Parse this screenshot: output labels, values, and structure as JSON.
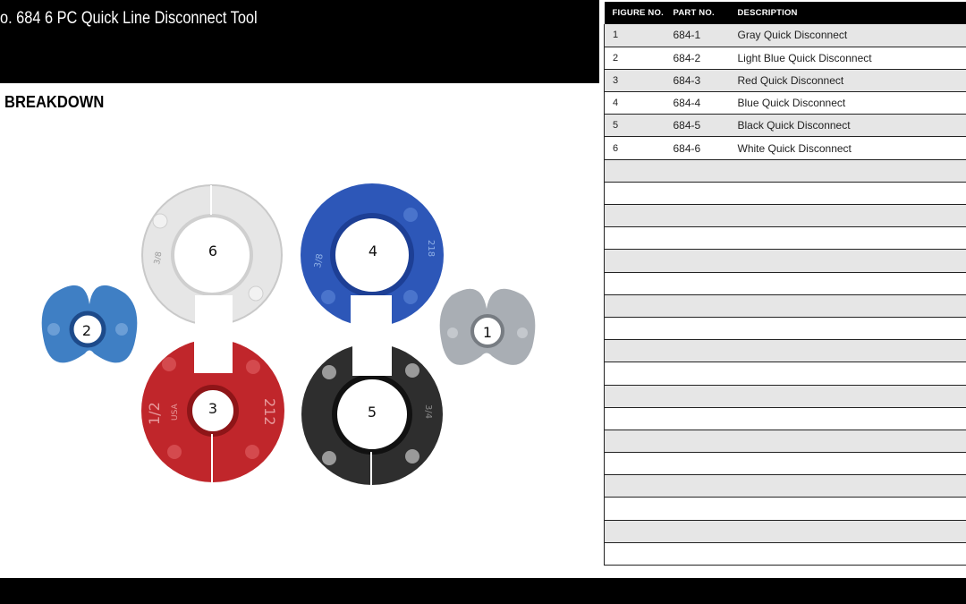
{
  "header": {
    "title": "o. 684 6 PC Quick Line Disconnect Tool"
  },
  "section": {
    "heading": "BREAKDOWN"
  },
  "table": {
    "columns": [
      "FIGURE NO.",
      "PART NO.",
      "DESCRIPTION"
    ],
    "rows": [
      [
        "1",
        "684-1",
        "Gray Quick Disconnect"
      ],
      [
        "2",
        "684-2",
        "Light Blue Quick Disconnect"
      ],
      [
        "3",
        "684-3",
        "Red Quick Disconnect"
      ],
      [
        "4",
        "684-4",
        "Blue Quick Disconnect"
      ],
      [
        "5",
        "684-5",
        "Black Quick Disconnect"
      ],
      [
        "6",
        "684-6",
        "White Quick Disconnect"
      ],
      [
        "",
        "",
        ""
      ],
      [
        "",
        "",
        ""
      ],
      [
        "",
        "",
        ""
      ],
      [
        "",
        "",
        ""
      ],
      [
        "",
        "",
        ""
      ],
      [
        "",
        "",
        ""
      ],
      [
        "",
        "",
        ""
      ],
      [
        "",
        "",
        ""
      ],
      [
        "",
        "",
        ""
      ],
      [
        "",
        "",
        ""
      ],
      [
        "",
        "",
        ""
      ],
      [
        "",
        "",
        ""
      ],
      [
        "",
        "",
        ""
      ],
      [
        "",
        "",
        ""
      ],
      [
        "",
        "",
        ""
      ],
      [
        "",
        "",
        ""
      ],
      [
        "",
        "",
        ""
      ],
      [
        "",
        "",
        ""
      ]
    ]
  },
  "figure": {
    "labels": [
      "1",
      "2",
      "3",
      "4",
      "5",
      "6"
    ],
    "part_icons": [
      "gray-disconnect-icon",
      "light-blue-disconnect-icon",
      "red-disconnect-icon",
      "blue-disconnect-icon",
      "black-disconnect-icon",
      "white-disconnect-icon"
    ],
    "ring_text": {
      "red_left": "1/2",
      "red_right": "212",
      "red_top": "USA",
      "blue_left": "3/8",
      "blue_right": "218",
      "white_left": "3/8",
      "black_right": "3/4"
    },
    "colors": {
      "gray": "#a9aeb4",
      "light_blue": "#3f7fc4",
      "red": "#c0262b",
      "blue": "#2d57b8",
      "black": "#2a2a2a",
      "white": "#e8e8e8"
    }
  }
}
